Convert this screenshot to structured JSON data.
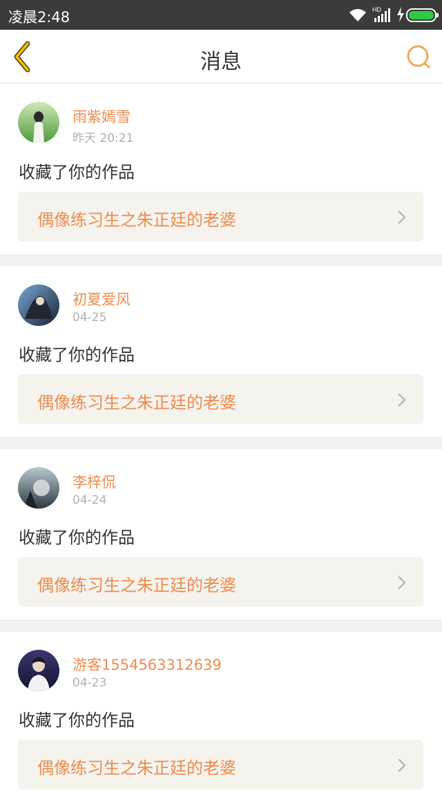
{
  "status_bar": {
    "time": "凌晨2:48",
    "icons": [
      "wifi-icon",
      "hd-signal-icon",
      "charging-icon",
      "battery-icon"
    ],
    "hd_label": "HD"
  },
  "nav": {
    "title": "消息",
    "back_icon": "chevron-left-icon",
    "search_icon": "search-icon",
    "accent_color": "#f0a85a"
  },
  "messages": [
    {
      "username": "雨紫嫣雪",
      "time": "昨天 20:21",
      "text": "收藏了你的作品",
      "work_title": "偶像练习生之朱正廷的老婆"
    },
    {
      "username": "初夏爱风",
      "time": "04-25",
      "text": "收藏了你的作品",
      "work_title": "偶像练习生之朱正廷的老婆"
    },
    {
      "username": "李梓侃",
      "time": "04-24",
      "text": "收藏了你的作品",
      "work_title": "偶像练习生之朱正廷的老婆"
    },
    {
      "username": "游客1554563312639",
      "time": "04-23",
      "text": "收藏了你的作品",
      "work_title": "偶像练习生之朱正廷的老婆"
    }
  ],
  "colors": {
    "username": "#ee8c4e",
    "work_title": "#ee8c4e",
    "work_box_bg": "#f4f3ee",
    "status_bar_bg": "#3b3b3b",
    "battery_green": "#2ecc40"
  }
}
